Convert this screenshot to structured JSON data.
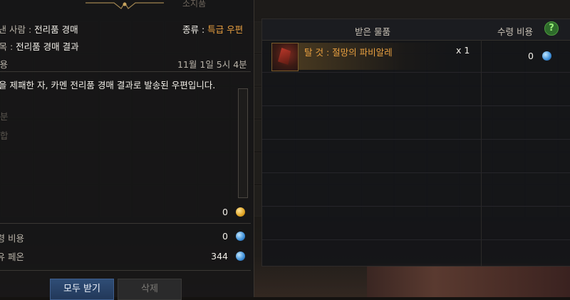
{
  "mail": {
    "panel_title": "소지품",
    "sender_label": "보낸 사람 :",
    "sender_value": "전리품 경매",
    "type_label": "종류 :",
    "type_value": "특급 우편",
    "subject_label": "제목 :",
    "subject_value": "전리품 경매 결과",
    "content_label": "내용",
    "date": "11월 1일 5시 4분",
    "body_text": "을 제패한 자, 카멘 전리품 경매 결과로 발송된 우편입니다.",
    "side_label_1": "분",
    "side_label_2": "합",
    "gold_value": "0",
    "fee_label": "수령 비용",
    "fee_value": "0",
    "phoenix_label": "보유 페온",
    "phoenix_value": "344",
    "receive_all_button": "모두 받기",
    "delete_button": "삭제"
  },
  "received": {
    "items_header": "받은 물품",
    "cost_header": "수령 비용",
    "help_icon": "?",
    "items": [
      {
        "name": "탈 것 : 절망의 파비알레",
        "quantity": "x 1",
        "cost": "0"
      }
    ]
  },
  "colors": {
    "accent_orange": "#e9a040",
    "button_blue": "#2f4d76",
    "help_green": "#2e6b2b"
  }
}
